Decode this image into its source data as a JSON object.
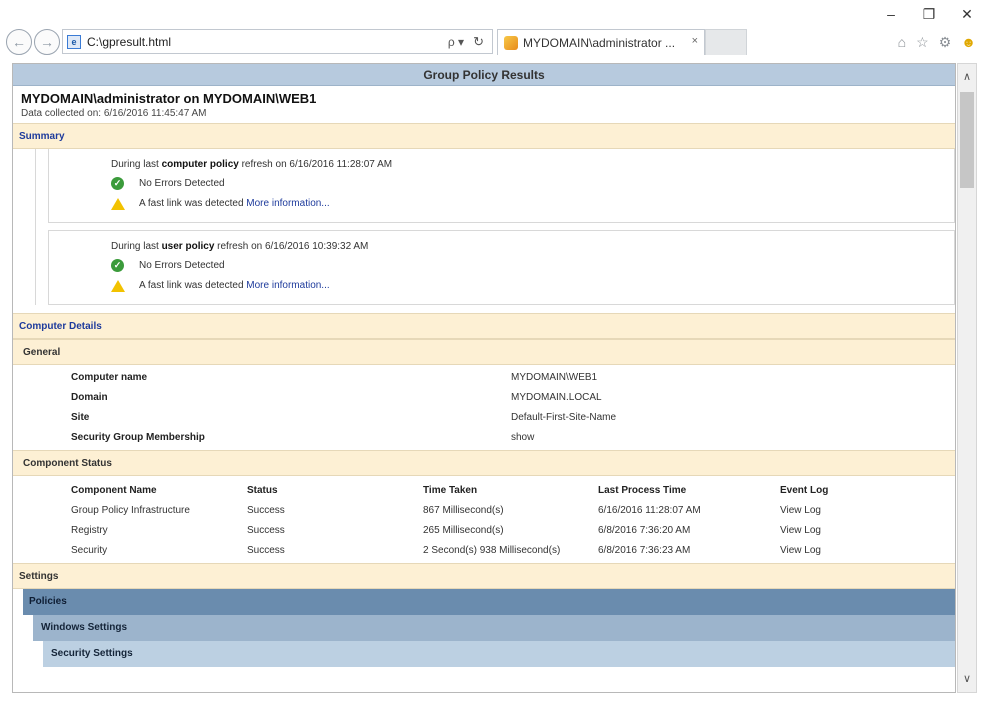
{
  "window": {
    "minimize_glyph": "–",
    "restore_glyph": "❐",
    "close_glyph": "✕"
  },
  "browser": {
    "address": "C:\\gpresult.html",
    "search_glyph": "ρ ▾",
    "refresh_glyph": "↻",
    "tab_title": "MYDOMAIN\\administrator ...",
    "tab_close": "×",
    "icons": [
      "home-icon",
      "star-icon",
      "settings-gear-icon",
      "feedback-smiley-icon"
    ]
  },
  "report": {
    "title": "Group Policy Results",
    "heading": "MYDOMAIN\\administrator on MYDOMAIN\\WEB1",
    "collected": "Data collected on: 6/16/2016 11:45:47 AM",
    "summary_label": "Summary",
    "computer_summary": {
      "prefix": "During last ",
      "bold": "computer policy",
      "suffix": " refresh on 6/16/2016 11:28:07 AM",
      "ok_text": "No Errors Detected",
      "warn_text": "A fast link was detected ",
      "more": "More information..."
    },
    "user_summary": {
      "prefix": "During last ",
      "bold": "user policy",
      "suffix": " refresh on 6/16/2016 10:39:32 AM",
      "ok_text": "No Errors Detected",
      "warn_text": "A fast link was detected ",
      "more": "More information..."
    },
    "computer_details_label": "Computer Details",
    "general_label": "General",
    "general": {
      "computer_name_key": "Computer name",
      "computer_name_val": "MYDOMAIN\\WEB1",
      "domain_key": "Domain",
      "domain_val": "MYDOMAIN.LOCAL",
      "site_key": "Site",
      "site_val": "Default-First-Site-Name",
      "sgm_key": "Security Group Membership",
      "sgm_val": "show"
    },
    "component_status_label": "Component Status",
    "component_status": {
      "headers": [
        "Component Name",
        "Status",
        "Time Taken",
        "Last Process Time",
        "Event Log"
      ],
      "rows": [
        [
          "Group Policy Infrastructure",
          "Success",
          "867 Millisecond(s)",
          "6/16/2016 11:28:07 AM",
          "View Log"
        ],
        [
          "Registry",
          "Success",
          "265 Millisecond(s)",
          "6/8/2016 7:36:20 AM",
          "View Log"
        ],
        [
          "Security",
          "Success",
          "2 Second(s) 938 Millisecond(s)",
          "6/8/2016 7:36:23 AM",
          "View Log"
        ]
      ]
    },
    "settings_label": "Settings",
    "policies_label": "Policies",
    "windows_settings_label": "Windows Settings",
    "security_settings_label": "Security Settings"
  }
}
